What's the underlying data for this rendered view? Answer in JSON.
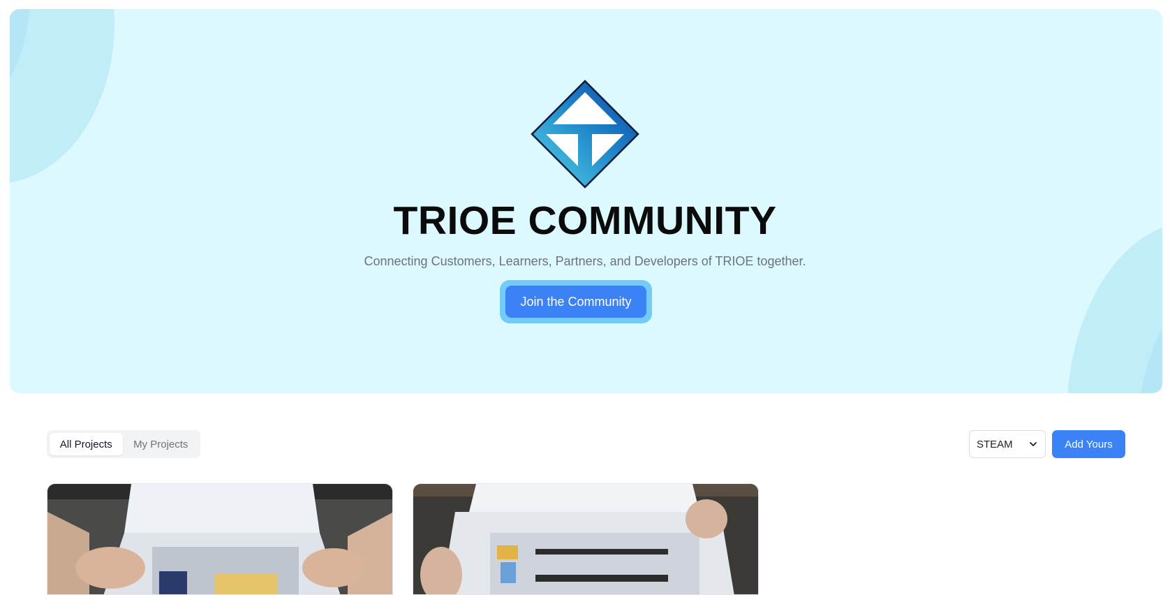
{
  "hero": {
    "title": "TRIOE COMMUNITY",
    "subtitle": "Connecting Customers, Learners, Partners, and Developers of TRIOE together.",
    "join_label": "Join the Community",
    "logo_icon": "trioe-diamond-logo"
  },
  "filters": {
    "tabs": [
      {
        "label": "All Projects",
        "active": true
      },
      {
        "label": "My Projects",
        "active": false
      }
    ],
    "category_select": "STEAM",
    "add_label": "Add Yours"
  },
  "projects": [
    {
      "thumbnail": "hands holding open white box with electronic modules"
    },
    {
      "thumbnail": "open white box with header pin strips and components"
    }
  ],
  "colors": {
    "hero_bg": "#dbf9fe",
    "accent": "#3b82f6",
    "join_ring": "#72cbf8",
    "logo_dark": "#0d47a1",
    "logo_light": "#4dd0e1"
  }
}
